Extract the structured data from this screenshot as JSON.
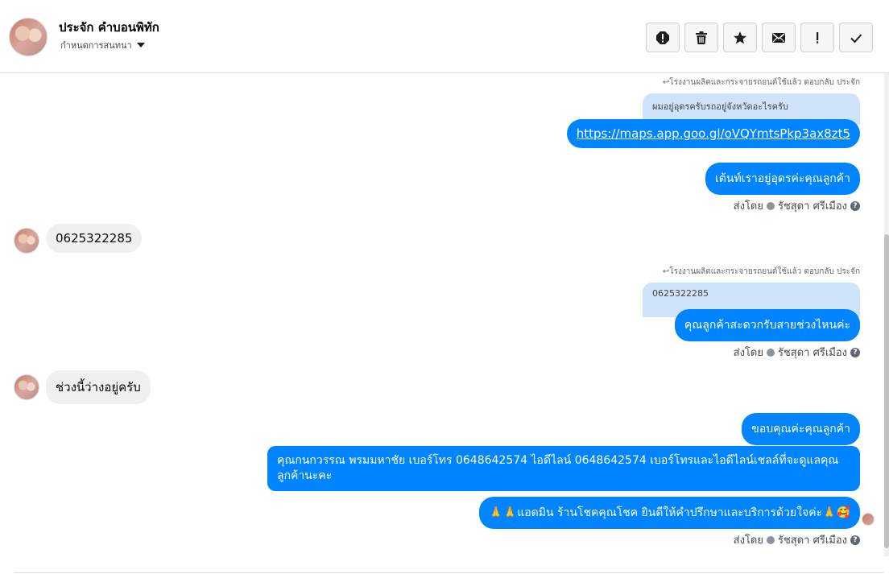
{
  "header": {
    "name": "ประจัก คำบอนพิทัก",
    "assign_label": "กำหนดการสนทนา"
  },
  "toolbar": {
    "buttons": [
      "spam-icon",
      "trash-icon",
      "star-icon",
      "mail-icon",
      "exclamation-icon",
      "check-icon"
    ]
  },
  "messages": {
    "reply_note_1": "โรงงานผลิตและกระจายรถยนต์ใช้แล้ว ตอบกลับ ประจัก",
    "quoted_1": "ผมอยู่อุดรครับรถอยู่จังหวัดอะไรครับ",
    "link_1": "https://maps.app.goo.gl/oVQYmtsPkp3ax8zt5",
    "out_1": "เต้นท์เราอยู่อุดรค่ะคุณลูกค้า",
    "sent_by_label": "ส่งโดย",
    "sender_name": "รัชสุดา ศรีเมือง",
    "incoming_1": "0625322285",
    "reply_note_2": "โรงงานผลิตและกระจายรถยนต์ใช้แล้ว ตอบกลับ ประจัก",
    "quoted_2": "0625322285",
    "out_2": "คุณลูกค้าสะดวกรับสายช่วงไหนค่ะ",
    "incoming_2": "ช่วงนี้ว่างอยู่ครับ",
    "out_3": "ขอบคุณค่ะคุณลูกค้า",
    "out_4": "คุณกนกวรรณ พรมมหาชัย      เบอร์โทร 0648642574  ไอดีไลน์ 0648642574    เบอร์โทรและไอดีไลน์เชลล์ที่จะดูแลคุณลูกค้านะคะ",
    "out_5": "🙏🙏แอดมิน ร้านโชคคุณโชค ยินดีให้คำปรึกษาและบริการด้วยใจค่ะ🙏🥰"
  }
}
